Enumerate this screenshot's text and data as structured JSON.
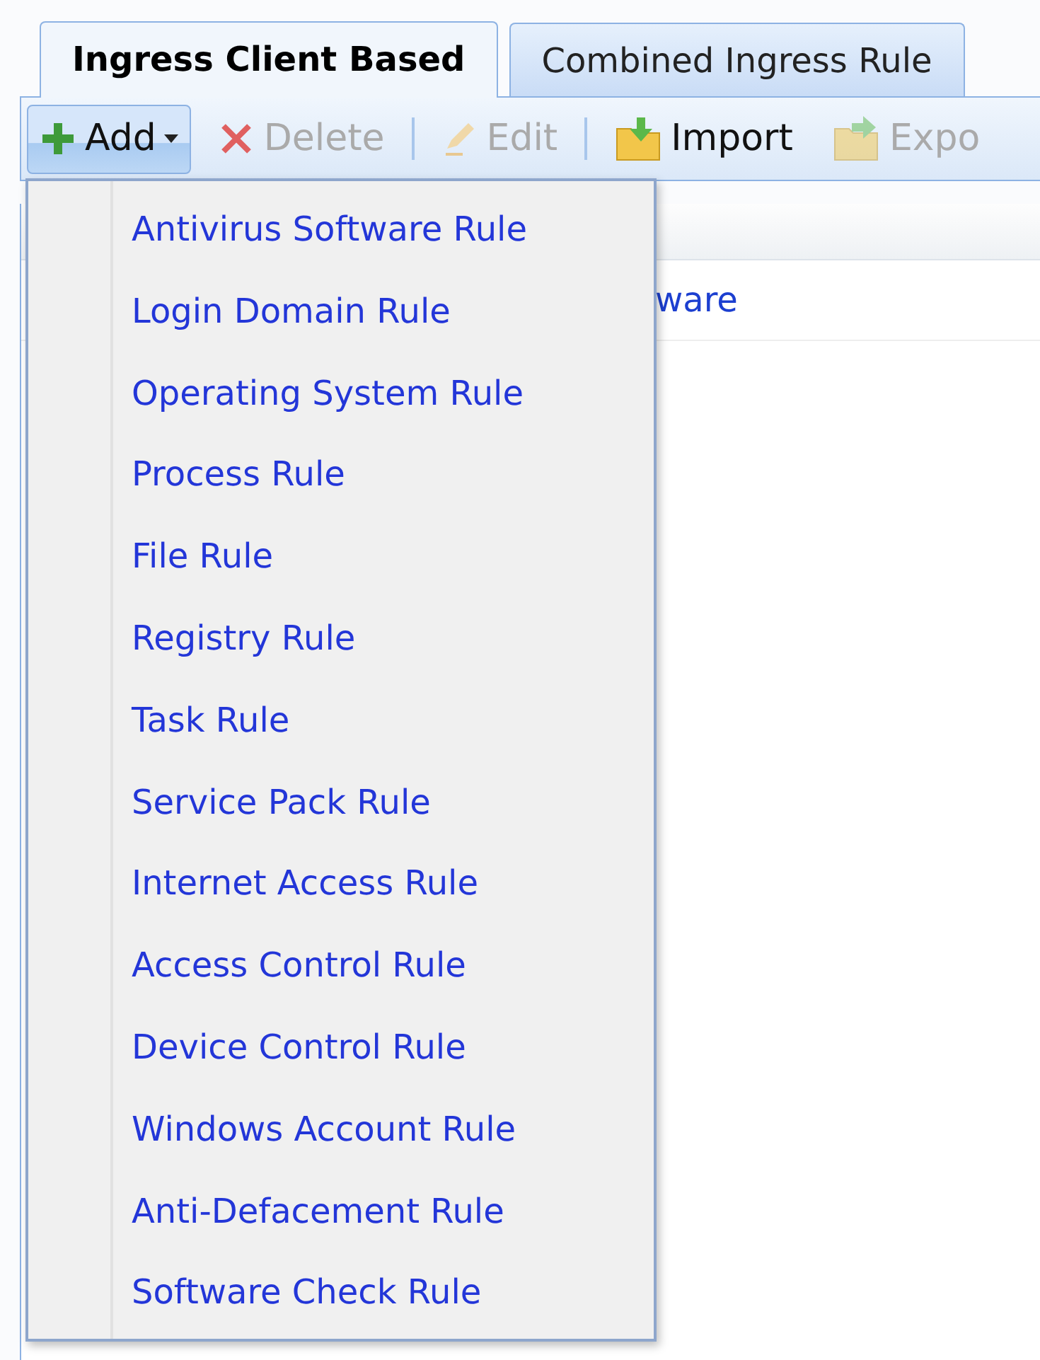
{
  "tabs": [
    {
      "label": "Ingress Client Based",
      "selected": true
    },
    {
      "label": "Combined Ingress Rule",
      "selected": false
    }
  ],
  "toolbar": [
    {
      "kind": "add",
      "label": "Add",
      "disabled": false,
      "pressed": true
    },
    {
      "kind": "delete",
      "label": "Delete",
      "disabled": true,
      "pressed": false
    },
    {
      "kind": "separator"
    },
    {
      "kind": "edit",
      "label": "Edit",
      "disabled": true,
      "pressed": false
    },
    {
      "kind": "separator"
    },
    {
      "kind": "import",
      "label": "Import",
      "disabled": false,
      "pressed": false
    },
    {
      "kind": "export",
      "label": "Expo",
      "disabled": true,
      "pressed": false
    }
  ],
  "grid": {
    "rows": [
      {
        "column_2": "ware"
      }
    ]
  },
  "add_menu": {
    "expanded": true,
    "items": [
      "Antivirus Software Rule",
      "Login Domain Rule",
      "Operating System Rule",
      "Process Rule",
      "File Rule",
      "Registry Rule",
      "Task Rule",
      "Service Pack Rule",
      "Internet Access Rule",
      "Access Control Rule",
      "Device Control Rule",
      "Windows Account Rule",
      "Anti-Defacement Rule",
      "Software Check Rule"
    ]
  }
}
